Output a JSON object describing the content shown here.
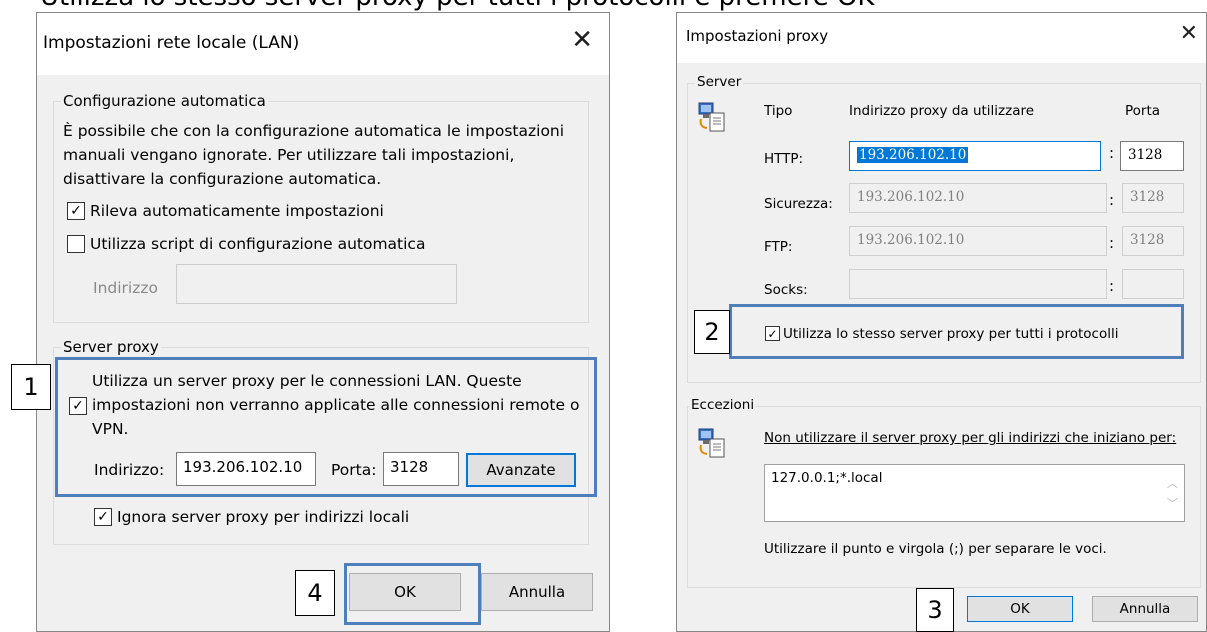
{
  "caption": "Utilizza lo stesso server proxy per tutti i protocolli e premere OK",
  "lan": {
    "title": "Impostazioni rete locale (LAN)",
    "auto_group": "Configurazione automatica",
    "auto_desc_1": "È possibile che con la configurazione automatica le impostazioni",
    "auto_desc_2": "manuali vengano ignorate. Per utilizzare tali impostazioni,",
    "auto_desc_3": "disattivare la configurazione automatica.",
    "detect": {
      "label": "Rileva automaticamente impostazioni",
      "checked": true
    },
    "script": {
      "label": "Utilizza script di configurazione automatica",
      "checked": false
    },
    "address_label": "Indirizzo",
    "address_value": "",
    "proxy_group": "Server proxy",
    "use_proxy": {
      "line1": "Utilizza un server proxy per le connessioni LAN. Queste",
      "line2": "impostazioni non verranno applicate alle connessioni remote o",
      "line3": "VPN.",
      "checked": true
    },
    "proxy_address_label": "Indirizzo:",
    "proxy_address_value": "193.206.102.10",
    "port_label": "Porta:",
    "port_value": "3128",
    "advanced_button": "Avanzate",
    "bypass_local": {
      "label": "Ignora server proxy per indirizzi locali",
      "checked": true
    },
    "ok_button": "OK",
    "cancel_button": "Annulla"
  },
  "proxy": {
    "title": "Impostazioni proxy",
    "server_group": "Server",
    "col_type": "Tipo",
    "col_address": "Indirizzo proxy da utilizzare",
    "col_port": "Porta",
    "rows": [
      {
        "label": "HTTP:",
        "address": "193.206.102.10",
        "port": "3128"
      },
      {
        "label": "Sicurezza:",
        "address": "193.206.102.10",
        "port": "3128"
      },
      {
        "label": "FTP:",
        "address": "193.206.102.10",
        "port": "3128"
      },
      {
        "label": "Socks:",
        "address": "",
        "port": ""
      }
    ],
    "same_proxy": {
      "label": "Utilizza lo stesso server proxy per tutti i protocolli",
      "checked": true
    },
    "exceptions_group": "Eccezioni",
    "exceptions_desc": "Non utilizzare il server proxy per gli indirizzi che iniziano per:",
    "exceptions_value": "127.0.0.1;*.local",
    "exceptions_hint": "Utilizzare il punto e virgola (;) per separare le voci.",
    "ok_button": "OK",
    "cancel_button": "Annulla"
  },
  "callouts": [
    "1",
    "2",
    "3",
    "4"
  ],
  "colors": {
    "highlight": "#4f7fba",
    "selection": "#0078d7",
    "dialog_bg": "#f0f0f0"
  },
  "icons": {
    "close": "close-icon",
    "check": "check-icon",
    "network": "network-computer-icon"
  }
}
